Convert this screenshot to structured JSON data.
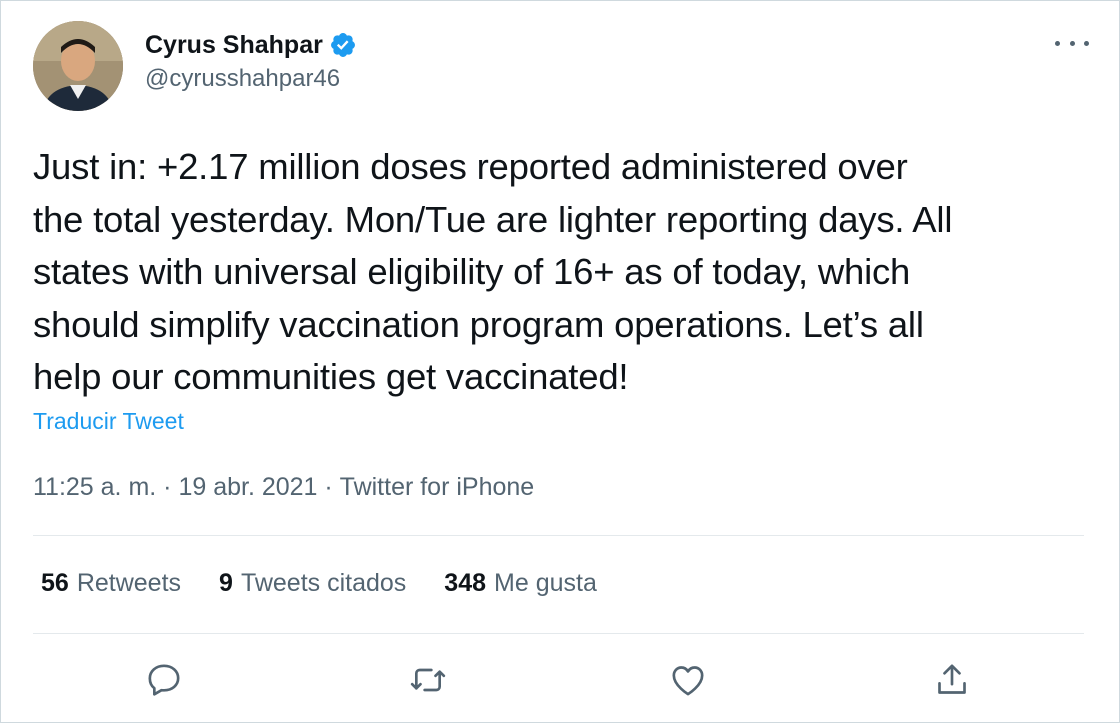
{
  "author": {
    "name": "Cyrus Shahpar",
    "handle": "@cyrusshahpar46",
    "verified_icon": "verified-badge-icon",
    "verified_color": "#1d9bf0"
  },
  "tweet": {
    "text": "Just in: +2.17 million doses reported administered over\nthe total yesterday. Mon/Tue are lighter reporting days. All\nstates with universal eligibility of 16+ as of today, which\nshould simplify vaccination program operations. Let’s all\nhelp our communities get vaccinated!",
    "translate_label": "Traducir Tweet",
    "time": "11:25 a. m.",
    "separator": " · ",
    "date": "19 abr. 2021",
    "source": "Twitter for iPhone"
  },
  "stats": {
    "retweets": {
      "count": "56",
      "label": "Retweets"
    },
    "quotes": {
      "count": "9",
      "label": "Tweets citados"
    },
    "likes": {
      "count": "348",
      "label": "Me gusta"
    }
  },
  "actions": {
    "reply_icon": "reply-icon",
    "retweet_icon": "retweet-icon",
    "like_icon": "heart-icon",
    "share_icon": "share-icon"
  },
  "colors": {
    "link": "#1d9bf0",
    "secondary_text": "#536471",
    "primary_text": "#0f1419"
  }
}
